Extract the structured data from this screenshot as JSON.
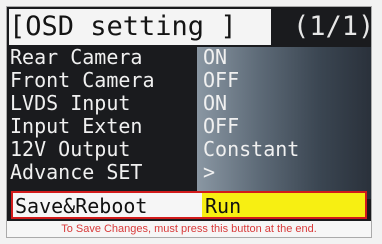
{
  "header": {
    "title": "[OSD setting ]",
    "page_indicator": "(1/1)"
  },
  "menu": {
    "items": [
      {
        "label": "Rear Camera",
        "value": "ON"
      },
      {
        "label": "Front Camera",
        "value": "OFF"
      },
      {
        "label": "LVDS Input",
        "value": "ON"
      },
      {
        "label": "Input Exten",
        "value": "OFF"
      },
      {
        "label": "12V Output",
        "value": "Constant"
      },
      {
        "label": "Advance SET",
        "value": ">"
      }
    ],
    "selected": {
      "label": "Save&Reboot",
      "value": "Run"
    }
  },
  "footer": {
    "note": "To Save Changes, must press this button at the end."
  },
  "colors": {
    "highlight": "#f7ef12",
    "selection_border": "#d21b1b",
    "note_text": "#d83a3a",
    "background": "#1a1b1e"
  }
}
